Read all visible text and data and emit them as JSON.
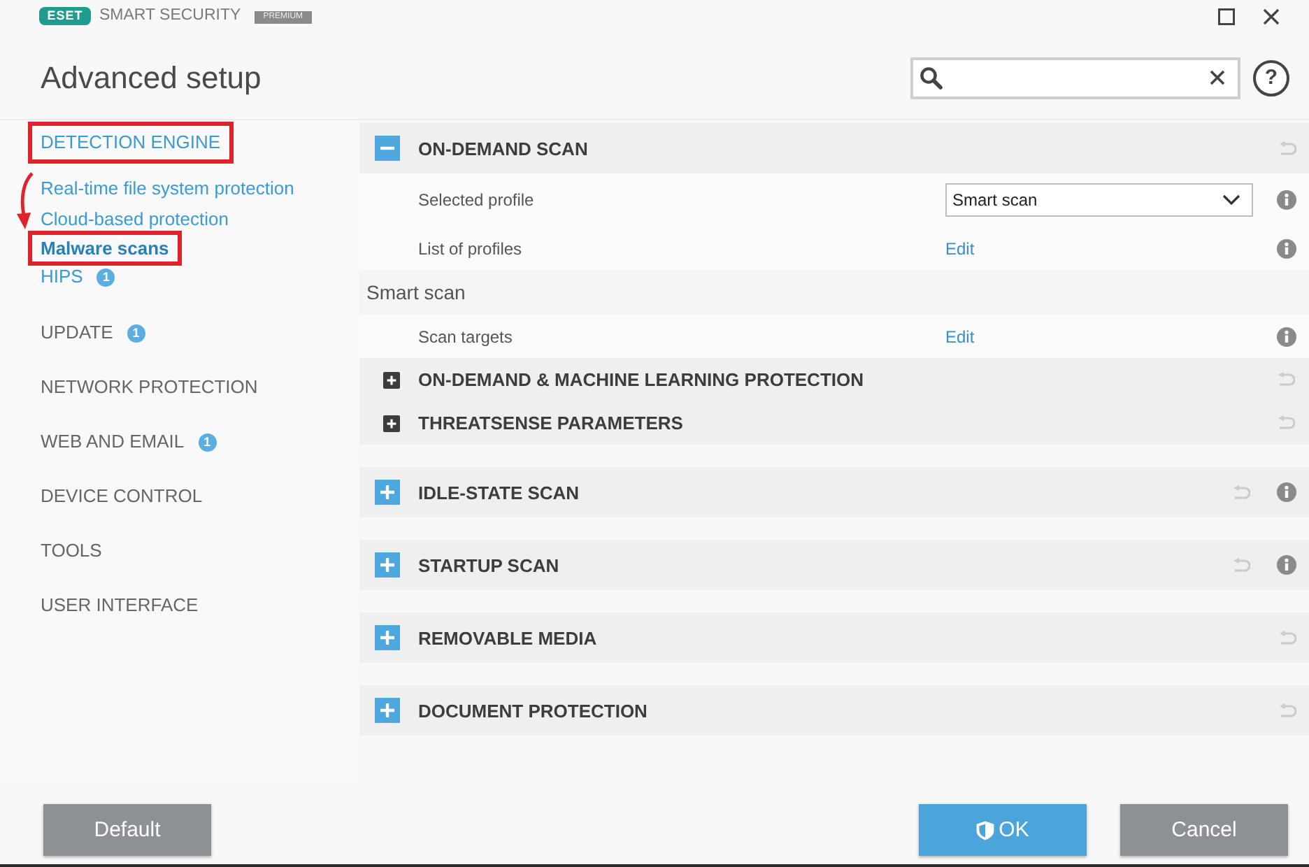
{
  "window": {
    "logo": "ESET",
    "product": "SMART SECURITY",
    "edition": "PREMIUM"
  },
  "header": {
    "title": "Advanced setup",
    "help": "?"
  },
  "sidebar": {
    "items": [
      {
        "label": "DETECTION ENGINE",
        "selected": false,
        "expanded": true,
        "annotated": true,
        "children": [
          {
            "label": "Real-time file system protection",
            "selected": false,
            "annotated": false
          },
          {
            "label": "Cloud-based protection",
            "selected": false,
            "annotated": false
          },
          {
            "label": "Malware scans",
            "selected": true,
            "annotated": true
          },
          {
            "label": "HIPS",
            "selected": false,
            "annotated": false,
            "badge": "1"
          }
        ]
      },
      {
        "label": "UPDATE",
        "selected": false,
        "expanded": false,
        "annotated": false,
        "badge": "1"
      },
      {
        "label": "NETWORK PROTECTION",
        "selected": false,
        "expanded": false,
        "annotated": false
      },
      {
        "label": "WEB AND EMAIL",
        "selected": false,
        "expanded": false,
        "annotated": false,
        "badge": "1"
      },
      {
        "label": "DEVICE CONTROL",
        "selected": false,
        "expanded": false,
        "annotated": false
      },
      {
        "label": "TOOLS",
        "selected": false,
        "expanded": false,
        "annotated": false
      },
      {
        "label": "USER INTERFACE",
        "selected": false,
        "expanded": false,
        "annotated": false
      }
    ]
  },
  "sections": [
    {
      "title": "ON-DEMAND SCAN",
      "expanded": true,
      "info": false,
      "rows": [
        {
          "kind": "dropdown",
          "label": "Selected profile",
          "value": "Smart scan",
          "info": true
        },
        {
          "kind": "link",
          "label": "List of profiles",
          "link": "Edit",
          "info": true
        },
        {
          "kind": "heading",
          "label": "Smart scan"
        },
        {
          "kind": "link",
          "label": "Scan targets",
          "link": "Edit",
          "info": true
        },
        {
          "kind": "subsection",
          "label": "ON-DEMAND & MACHINE LEARNING PROTECTION",
          "expanded": false
        },
        {
          "kind": "subsection",
          "label": "THREATSENSE PARAMETERS",
          "expanded": false
        }
      ]
    },
    {
      "title": "IDLE-STATE SCAN",
      "expanded": false,
      "info": true
    },
    {
      "title": "STARTUP SCAN",
      "expanded": false,
      "info": true
    },
    {
      "title": "REMOVABLE MEDIA",
      "expanded": false,
      "info": false
    },
    {
      "title": "DOCUMENT PROTECTION",
      "expanded": false,
      "info": false
    }
  ],
  "footer": {
    "left_buttons": [
      {
        "label": "Default",
        "kind": "secondary"
      }
    ],
    "right_buttons": [
      {
        "label": "OK",
        "kind": "primary"
      },
      {
        "label": "Cancel",
        "kind": "secondary"
      }
    ]
  }
}
